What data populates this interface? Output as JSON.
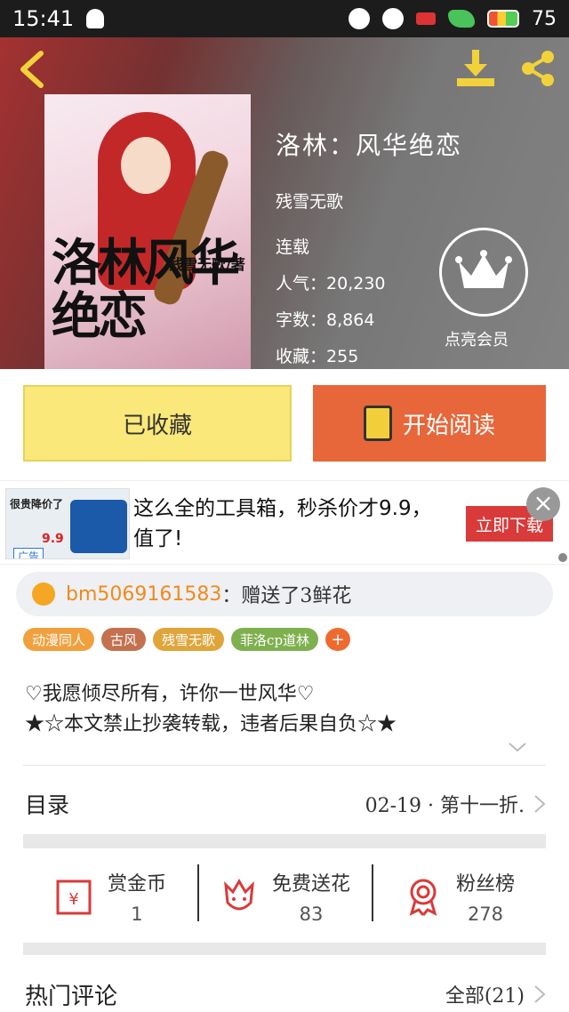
{
  "status_bar": {
    "time": "15:41",
    "battery": "75"
  },
  "book": {
    "title": "洛林：风华绝恋",
    "cover_title": "洛林风华绝恋",
    "cover_author": "残雪无歌/著",
    "author": "残雪无歌",
    "status": "连载",
    "popularity_label": "人气：",
    "popularity": "20,230",
    "wordcount_label": "字数：",
    "wordcount": "8,864",
    "collections_label": "收藏：",
    "collections": "255",
    "vip_label": "点亮会员"
  },
  "actions": {
    "collected_label": "已收藏",
    "read_label": "开始阅读"
  },
  "ad": {
    "thumb_label": "很贵降价了",
    "thumb_price": "9.9",
    "tag": "广告",
    "text": "这么全的工具箱，秒杀价才9.9，值了!",
    "cta": "立即下载",
    "close": "×"
  },
  "gift_notice": {
    "user": "bm5069161583",
    "message": "：赠送了3鲜花"
  },
  "tags": [
    {
      "label": "动漫同人",
      "color": "#f2a03d"
    },
    {
      "label": "古风",
      "color": "#c4714f"
    },
    {
      "label": "残雪无歌",
      "color": "#e0a53a"
    },
    {
      "label": "菲洛cp道林",
      "color": "#7fb04e"
    }
  ],
  "tag_add": "+",
  "description": {
    "line1": "♡我愿倾尽所有，许你一世风华♡",
    "line2": "★☆本文禁止抄袭转载，违者后果自负☆★"
  },
  "toc": {
    "label": "目录",
    "latest": "02-19 · 第十一折."
  },
  "gifts": [
    {
      "name": "赏金币",
      "count": "1"
    },
    {
      "name": "免费送花",
      "count": "83"
    },
    {
      "name": "粉丝榜",
      "count": "278"
    }
  ],
  "comments": {
    "label": "热门评论",
    "all": "全部(21)"
  },
  "colors": {
    "accent_orange": "#e7673a",
    "collected_yellow": "#fbe87a",
    "red_icon": "#d93a3a"
  }
}
